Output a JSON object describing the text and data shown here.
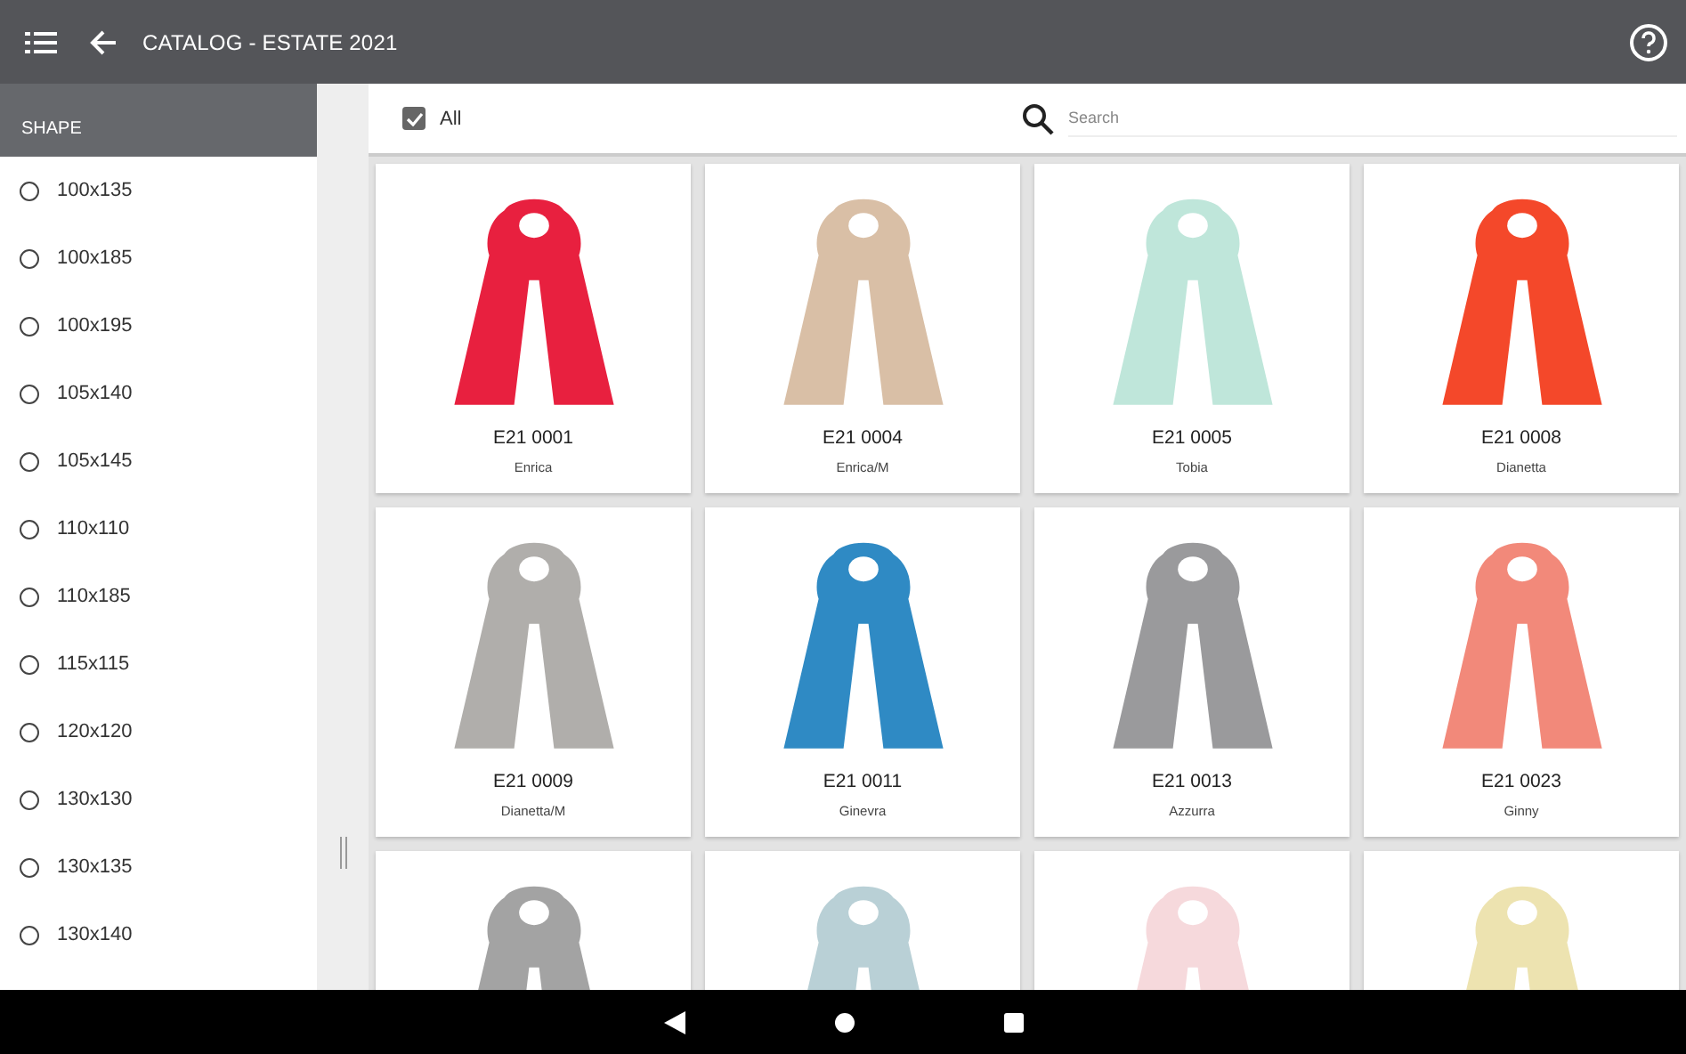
{
  "app_bar": {
    "title": "CATALOG - ESTATE 2021"
  },
  "sidebar": {
    "header": "SHAPE",
    "items": [
      {
        "label": "100x135",
        "selected": false
      },
      {
        "label": "100x185",
        "selected": false
      },
      {
        "label": "100x195",
        "selected": false
      },
      {
        "label": "105x140",
        "selected": false
      },
      {
        "label": "105x145",
        "selected": false
      },
      {
        "label": "110x110",
        "selected": false
      },
      {
        "label": "110x185",
        "selected": false
      },
      {
        "label": "115x115",
        "selected": false
      },
      {
        "label": "120x120",
        "selected": false
      },
      {
        "label": "130x130",
        "selected": false
      },
      {
        "label": "130x135",
        "selected": false
      },
      {
        "label": "130x140",
        "selected": false
      }
    ]
  },
  "toolbar": {
    "all": {
      "label": "All",
      "checked": true
    },
    "search": {
      "placeholder": "Search"
    }
  },
  "products": [
    {
      "code": "E21 0001",
      "name": "Enrica",
      "color": "#e8203f"
    },
    {
      "code": "E21 0004",
      "name": "Enrica/M",
      "color": "#d9bfa6"
    },
    {
      "code": "E21 0005",
      "name": "Tobia",
      "color": "#bfe6da"
    },
    {
      "code": "E21 0008",
      "name": "Dianetta",
      "color": "#f4482a"
    },
    {
      "code": "E21 0009",
      "name": "Dianetta/M",
      "color": "#b0aeab"
    },
    {
      "code": "E21 0011",
      "name": "Ginevra",
      "color": "#2f8ac4"
    },
    {
      "code": "E21 0013",
      "name": "Azzurra",
      "color": "#9a9a9c"
    },
    {
      "code": "E21 0023",
      "name": "Ginny",
      "color": "#f2897a"
    },
    {
      "color": "#a3a3a3"
    },
    {
      "color": "#b9d0d6"
    },
    {
      "color": "#f6d9dc"
    },
    {
      "color": "#ede3b0"
    }
  ]
}
